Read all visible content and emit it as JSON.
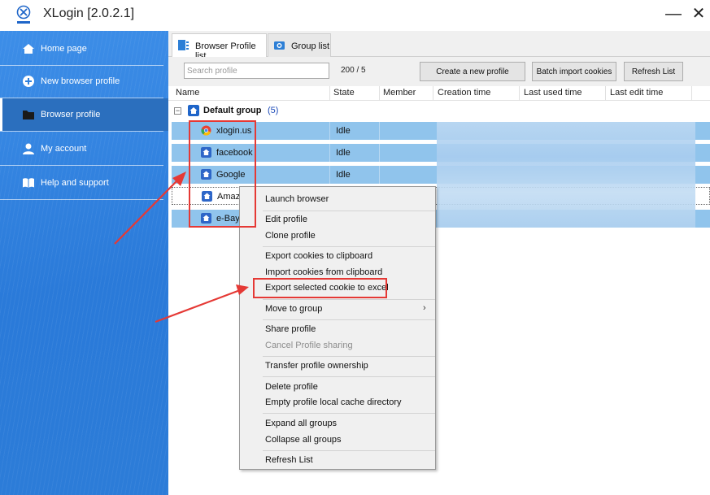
{
  "window": {
    "title": "XLogin [2.0.2.1]",
    "min_label": "—",
    "close_label": "✕"
  },
  "sidebar": {
    "items": [
      {
        "label": "Home page",
        "icon": "home-icon"
      },
      {
        "label": "New browser profile",
        "icon": "plus-circle-icon"
      },
      {
        "label": "Browser profile",
        "icon": "folder-icon",
        "active": true
      },
      {
        "label": "My account",
        "icon": "user-icon"
      },
      {
        "label": "Help and support",
        "icon": "book-icon"
      }
    ]
  },
  "tabs": [
    {
      "label": "Browser Profile list",
      "active": true
    },
    {
      "label": "Group list",
      "active": false
    }
  ],
  "toolbar": {
    "search_placeholder": "Search profile",
    "count": "200 / 5",
    "create_label": "Create a new profile",
    "batch_label": "Batch import cookies",
    "refresh_label": "Refresh List"
  },
  "table": {
    "columns": [
      "Name",
      "State",
      "Member",
      "Creation time",
      "Last used time",
      "Last edit time"
    ],
    "group": {
      "expander": "−",
      "name": "Default group",
      "count": "(5)"
    },
    "rows": [
      {
        "name": "xlogin.us",
        "state": "Idle",
        "icon": "chrome-icon"
      },
      {
        "name": "facebook",
        "state": "Idle",
        "icon": "home-icon"
      },
      {
        "name": "Google",
        "state": "Idle",
        "icon": "home-icon"
      },
      {
        "name": "Amazo",
        "state": "",
        "icon": "home-icon"
      },
      {
        "name": "e-Bay",
        "state": "",
        "icon": "home-icon"
      }
    ]
  },
  "context_menu": {
    "items": [
      {
        "label": "Launch browser"
      },
      {
        "label": "Edit profile"
      },
      {
        "label": "Clone profile"
      },
      {
        "label": "Export cookies to clipboard"
      },
      {
        "label": "Import cookies from clipboard"
      },
      {
        "label": "Export selected cookie to excel"
      },
      {
        "label": "Move to group",
        "submenu": "›"
      },
      {
        "label": "Share profile"
      },
      {
        "label": "Cancel Profile sharing",
        "disabled": true
      },
      {
        "label": "Transfer profile ownership"
      },
      {
        "label": "Delete profile"
      },
      {
        "label": "Empty profile local cache directory"
      },
      {
        "label": "Expand all groups"
      },
      {
        "label": "Collapse all groups"
      },
      {
        "label": "Refresh List"
      }
    ]
  },
  "colors": {
    "sidebar": "#2f80dc",
    "row_selected": "#90c4ec",
    "annotation": "#e53935",
    "group_count": "#1c4ab8"
  }
}
